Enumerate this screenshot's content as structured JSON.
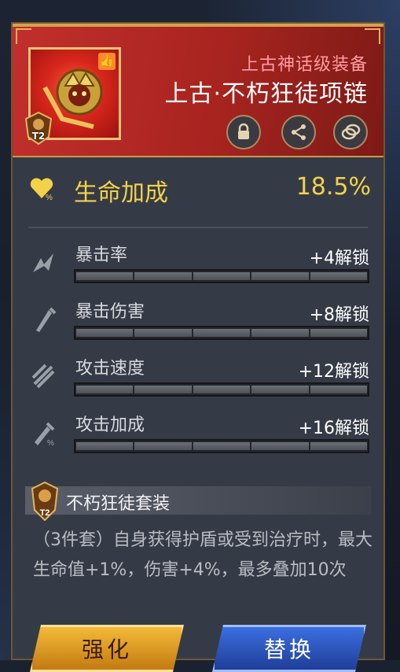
{
  "item": {
    "rarity": "上古神话级装备",
    "name": "上古·不朽狂徒项链",
    "tier": "T2"
  },
  "actions": [
    {
      "icon": "lock-icon"
    },
    {
      "icon": "share-icon"
    },
    {
      "icon": "coins-icon"
    }
  ],
  "main_stat": {
    "label": "生命加成",
    "value": "18.5%"
  },
  "sub_stats": [
    {
      "label": "暴击率",
      "unlock": "+4解锁",
      "icon": "crit-rate-icon"
    },
    {
      "label": "暴击伤害",
      "unlock": "+8解锁",
      "icon": "crit-damage-icon"
    },
    {
      "label": "攻击速度",
      "unlock": "+12解锁",
      "icon": "attack-speed-icon"
    },
    {
      "label": "攻击加成",
      "unlock": "+16解锁",
      "icon": "attack-bonus-icon"
    }
  ],
  "set": {
    "tier": "T2",
    "title": "不朽狂徒套装",
    "description": "（3件套）自身获得护盾或受到治疗时，最大生命值+1%，伤害+4%，最多叠加10次"
  },
  "buttons": {
    "strengthen": "强化",
    "replace": "替换"
  },
  "colors": {
    "accent_gold": "#f3d24a",
    "header_red": "#c22f2c",
    "replace_blue": "#2b55c2"
  }
}
